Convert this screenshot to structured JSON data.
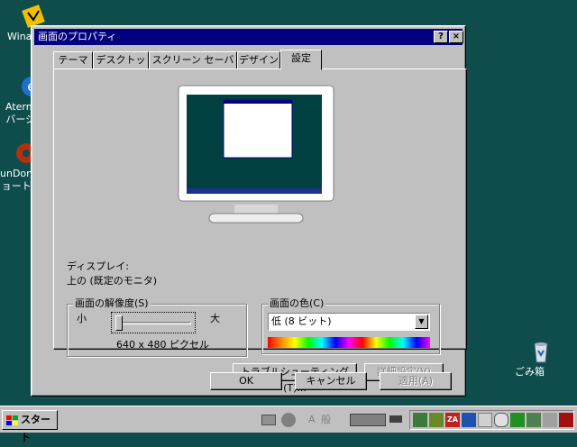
{
  "desktop": {
    "icons": [
      {
        "label": "Winar",
        "icon": "winamp-icon"
      },
      {
        "label": "Atermワン\nバージョン",
        "icon": "ie-icon"
      },
      {
        "label": "unDonut\nョートカ",
        "icon": "undonut-icon"
      },
      {
        "label": "ごみ箱",
        "icon": "recycle-bin-icon"
      }
    ]
  },
  "window": {
    "title": "画面のプロパティ",
    "help_btn": "?",
    "close_btn": "×",
    "tabs": [
      "テーマ",
      "デスクトップ",
      "スクリーン セーバー",
      "デザイン",
      "設定"
    ],
    "active_tab": 4
  },
  "settings": {
    "display_label": "ディスプレイ:",
    "display_value": "上の (既定のモニタ)",
    "resolution": {
      "group_label": "画面の解像度(S)",
      "small": "小",
      "large": "大",
      "value": "640 x 480 ピクセル",
      "slider_level": 0
    },
    "color": {
      "group_label": "画面の色(C)",
      "selected": "低 (8 ビット)"
    },
    "troubleshoot_btn": "トラブルシューティング(T)...",
    "advanced_btn": "詳細設定(V)"
  },
  "buttons": {
    "ok": "OK",
    "cancel": "キャンセル",
    "apply": "適用(A)"
  },
  "taskbar": {
    "start": "スタート",
    "ime_a": "A",
    "ime_mode": "般"
  },
  "colors": {
    "desktop": "#0f4c4c",
    "titlebar": "#000080",
    "face": "#c0c0c0"
  }
}
